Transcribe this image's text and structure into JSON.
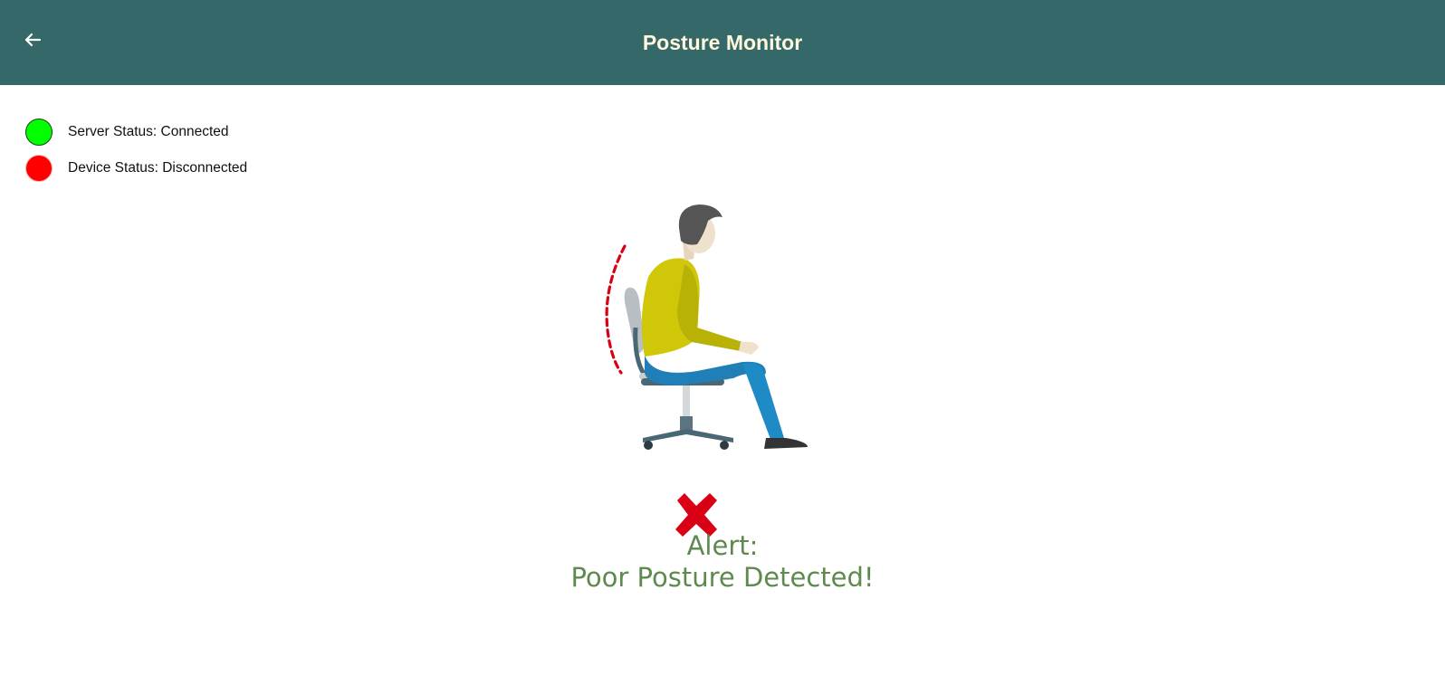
{
  "header": {
    "title": "Posture Monitor",
    "back_icon": "arrow-left-icon"
  },
  "status": {
    "server": {
      "label": "Server Status: Connected",
      "color": "#00ff00"
    },
    "device": {
      "label": "Device Status: Disconnected",
      "color": "#ff0000"
    }
  },
  "illustration": {
    "icon": "slouching-person-icon"
  },
  "alert": {
    "icon": "red-x-icon",
    "icon_color": "#d90015",
    "line1": "Alert:",
    "line2": "Poor Posture Detected!",
    "text_color": "#5e8a4f"
  }
}
